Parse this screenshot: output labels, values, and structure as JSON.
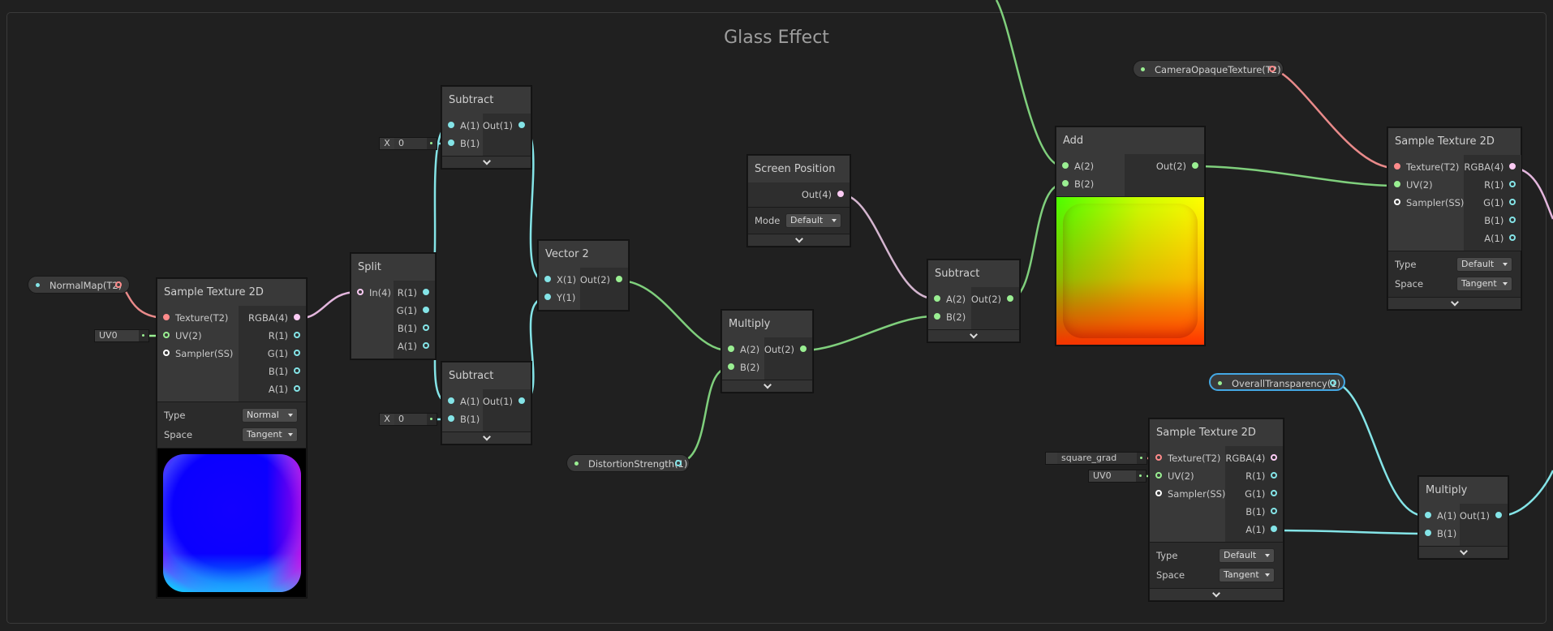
{
  "group": {
    "title": "Glass Effect"
  },
  "colors": {
    "float": "#84e4e7",
    "vec2": "#9aef92",
    "vec4": "#fbcbf4",
    "texture": "#ff8b8b",
    "sampler": "#ffffff",
    "selection": "#44a8e4"
  },
  "properties": {
    "normal_map": "NormalMap(T2)",
    "camera_opaque": "CameraOpaqueTexture(T2)",
    "distortion": "DistortionStrength(1)",
    "overall_transparency": "OverallTransparency(1)"
  },
  "nodes": {
    "sample_tex_a": {
      "title": "Sample Texture 2D",
      "inputs": [
        "Texture(T2)",
        "UV(2)",
        "Sampler(SS)"
      ],
      "outputs": [
        "RGBA(4)",
        "R(1)",
        "G(1)",
        "B(1)",
        "A(1)"
      ],
      "type_label": "Type",
      "type_value": "Normal",
      "space_label": "Space",
      "space_value": "Tangent",
      "uv_field": "UV0"
    },
    "split": {
      "title": "Split",
      "inputs": [
        "In(4)"
      ],
      "outputs": [
        "R(1)",
        "G(1)",
        "B(1)",
        "A(1)"
      ]
    },
    "subtract_top": {
      "title": "Subtract",
      "inputs": [
        "A(1)",
        "B(1)"
      ],
      "outputs": [
        "Out(1)"
      ],
      "x_label": "X",
      "x_value": "0"
    },
    "subtract_bottom": {
      "title": "Subtract",
      "inputs": [
        "A(1)",
        "B(1)"
      ],
      "outputs": [
        "Out(1)"
      ],
      "x_label": "X",
      "x_value": "0"
    },
    "vector2": {
      "title": "Vector 2",
      "inputs": [
        "X(1)",
        "Y(1)"
      ],
      "outputs": [
        "Out(2)"
      ]
    },
    "screen_position": {
      "title": "Screen Position",
      "outputs": [
        "Out(4)"
      ],
      "mode_label": "Mode",
      "mode_value": "Default"
    },
    "multiply_mid": {
      "title": "Multiply",
      "inputs": [
        "A(2)",
        "B(2)"
      ],
      "outputs": [
        "Out(2)"
      ]
    },
    "subtract_mid": {
      "title": "Subtract",
      "inputs": [
        "A(2)",
        "B(2)"
      ],
      "outputs": [
        "Out(2)"
      ]
    },
    "add": {
      "title": "Add",
      "inputs": [
        "A(2)",
        "B(2)"
      ],
      "outputs": [
        "Out(2)"
      ]
    },
    "sample_tex_b": {
      "title": "Sample Texture 2D",
      "inputs": [
        "Texture(T2)",
        "UV(2)",
        "Sampler(SS)"
      ],
      "outputs": [
        "RGBA(4)",
        "R(1)",
        "G(1)",
        "B(1)",
        "A(1)"
      ],
      "type_label": "Type",
      "type_value": "Default",
      "space_label": "Space",
      "space_value": "Tangent"
    },
    "sample_tex_c": {
      "title": "Sample Texture 2D",
      "inputs": [
        "Texture(T2)",
        "UV(2)",
        "Sampler(SS)"
      ],
      "outputs": [
        "RGBA(4)",
        "R(1)",
        "G(1)",
        "B(1)",
        "A(1)"
      ],
      "type_label": "Type",
      "type_value": "Default",
      "space_label": "Space",
      "space_value": "Tangent",
      "texture_field": "square_grad",
      "uv_field": "UV0"
    },
    "multiply_right": {
      "title": "Multiply",
      "inputs": [
        "A(1)",
        "B(1)"
      ],
      "outputs": [
        "Out(1)"
      ]
    }
  }
}
